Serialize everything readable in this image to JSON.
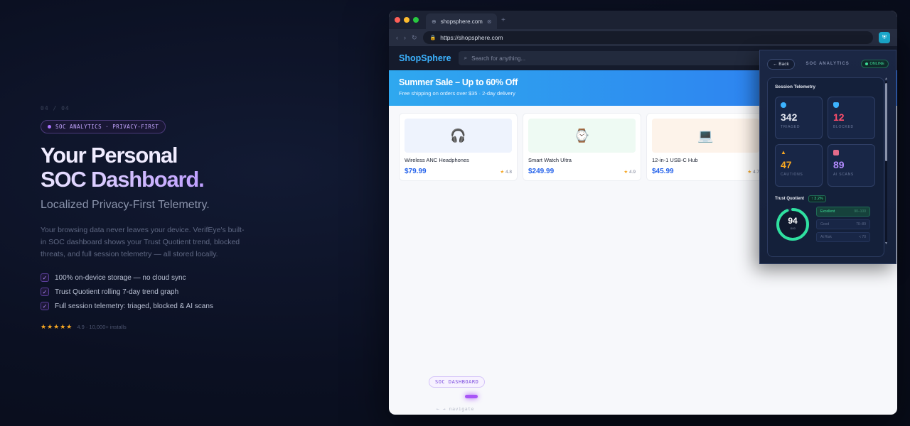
{
  "left": {
    "counter": "04 / 04",
    "pill": "SOC ANALYTICS · PRIVACY-FIRST",
    "headline_1": "Your Personal",
    "headline_2": "SOC Dashboard.",
    "subhead": "Localized Privacy-First Telemetry.",
    "body": "Your browsing data never leaves your device. VerifEye's built-in SOC dashboard shows your Trust Quotient trend, blocked threats, and full session telemetry — all stored locally.",
    "checks": [
      "100% on-device storage — no cloud sync",
      "Trust Quotient rolling 7-day trend graph",
      "Full session telemetry: triaged, blocked & AI scans"
    ],
    "stars": "★★★★★",
    "rating_text": "4.9 · 10,000+ installs"
  },
  "browser": {
    "tab_title": "shopsphere.com",
    "new_tab": "+",
    "url": "https://shopsphere.com",
    "site": {
      "logo": "ShopSphere",
      "search_placeholder": "Search for anything...",
      "hero_title": "Summer Sale – Up to 60% Off",
      "hero_sub": "Free shipping on orders over $35 · 2-day delivery",
      "products": [
        {
          "name": "Wireless ANC Headphones",
          "price": "$79.99",
          "rating": "4.8",
          "emoji": "🎧",
          "bg": "#eef3fd"
        },
        {
          "name": "Smart Watch Ultra",
          "price": "$249.99",
          "rating": "4.9",
          "emoji": "⌚",
          "bg": "#eefaf3"
        },
        {
          "name": "12-in-1 USB-C Hub",
          "price": "$45.99",
          "rating": "4.7",
          "emoji": "💻",
          "bg": "#fdf3ea"
        }
      ]
    },
    "soc_pill": "SOC DASHBOARD",
    "nav_hint": "← → navigate"
  },
  "popup": {
    "back": "← Back",
    "title": "SOC ANALYTICS",
    "status": "ONLINE",
    "telemetry_title": "Session Telemetry",
    "stats": [
      {
        "value": "342",
        "label": "TRIAGED",
        "color": "#e6e9f2",
        "icon_color": "#3cb3ff"
      },
      {
        "value": "12",
        "label": "BLOCKED",
        "color": "#ff4d6a",
        "icon_color": "#3cb3ff"
      },
      {
        "value": "47",
        "label": "CAUTIONS",
        "color": "#f5a623",
        "icon_color": "#f5a623"
      },
      {
        "value": "89",
        "label": "AI SCANS",
        "color": "#b48cff",
        "icon_color": "#e56b8a"
      }
    ],
    "tq_label": "Trust Quotient",
    "tq_delta": "↑ 3.2%",
    "tq_value": "94",
    "tq_sub": "/100",
    "tq_fraction": 0.94,
    "tiers": [
      {
        "label": "Excellent",
        "range": "90–100",
        "active": true
      },
      {
        "label": "Good",
        "range": "70–89",
        "active": false
      },
      {
        "label": "At Risk",
        "range": "< 70",
        "active": false
      }
    ]
  }
}
